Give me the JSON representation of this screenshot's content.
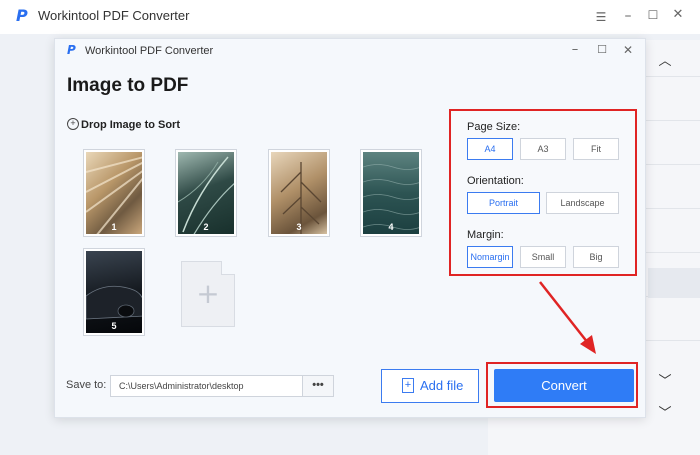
{
  "app": {
    "title": "Workintool PDF Converter",
    "logo_letter": "P",
    "accent_color": "#2f7cf6",
    "highlight_color": "#e02424"
  },
  "window_controls": [
    "minimize-icon",
    "maximize-icon",
    "close-icon"
  ],
  "dialog": {
    "title": "Workintool PDF Converter",
    "heading": "Image to PDF",
    "sort_label": "Drop Image to Sort",
    "images": [
      {
        "number": "1",
        "description": "architecture"
      },
      {
        "number": "2",
        "description": "leaves"
      },
      {
        "number": "3",
        "description": "palm leaf"
      },
      {
        "number": "4",
        "description": "sea"
      },
      {
        "number": "5",
        "description": "car"
      }
    ],
    "add_placeholder_icon": "plus-icon"
  },
  "options": {
    "page_size": {
      "label": "Page Size:",
      "choices": [
        "A4",
        "A3",
        "Fit"
      ],
      "selected": "A4"
    },
    "orientation": {
      "label": "Orientation:",
      "choices": [
        "Portrait",
        "Landscape"
      ],
      "selected": "Portrait"
    },
    "margin": {
      "label": "Margin:",
      "choices": [
        "Nomargin",
        "Small",
        "Big"
      ],
      "selected": "Nomargin"
    }
  },
  "bottom": {
    "save_label": "Save to:",
    "save_path": "C:\\Users\\Administrator\\desktop",
    "more_label": "•••",
    "add_file_label": "Add file",
    "convert_label": "Convert"
  }
}
